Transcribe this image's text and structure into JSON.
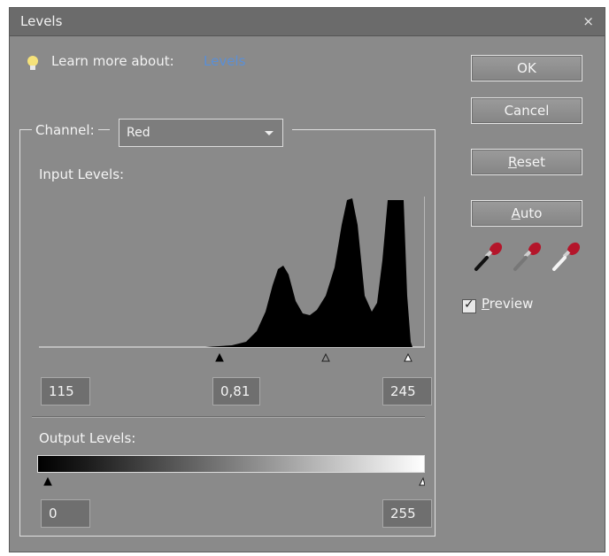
{
  "window": {
    "title": "Levels",
    "close_symbol": "×"
  },
  "learn": {
    "text": "Learn more about:",
    "link": "Levels"
  },
  "buttons": {
    "ok": "OK",
    "cancel": "Cancel",
    "reset_first": "R",
    "reset_rest": "eset",
    "auto_first": "A",
    "auto_rest": "uto"
  },
  "eyedroppers": [
    "black-point-eyedropper-icon",
    "gray-point-eyedropper-icon",
    "white-point-eyedropper-icon"
  ],
  "preview": {
    "checked": true,
    "check_symbol": "✓",
    "label_first": "P",
    "label_rest": "review"
  },
  "channel": {
    "label": "Channel:",
    "selected": "Red"
  },
  "input_levels": {
    "label": "Input Levels:",
    "black": "115",
    "gamma": "0,81",
    "white": "245"
  },
  "output_levels": {
    "label": "Output Levels:",
    "black": "0",
    "white": "255"
  },
  "colors": {
    "dialog_bg": "#8a8a8a",
    "titlebar": "#6b6b6b",
    "link": "#5a8fd6",
    "dropper_red": "#b4152a"
  }
}
